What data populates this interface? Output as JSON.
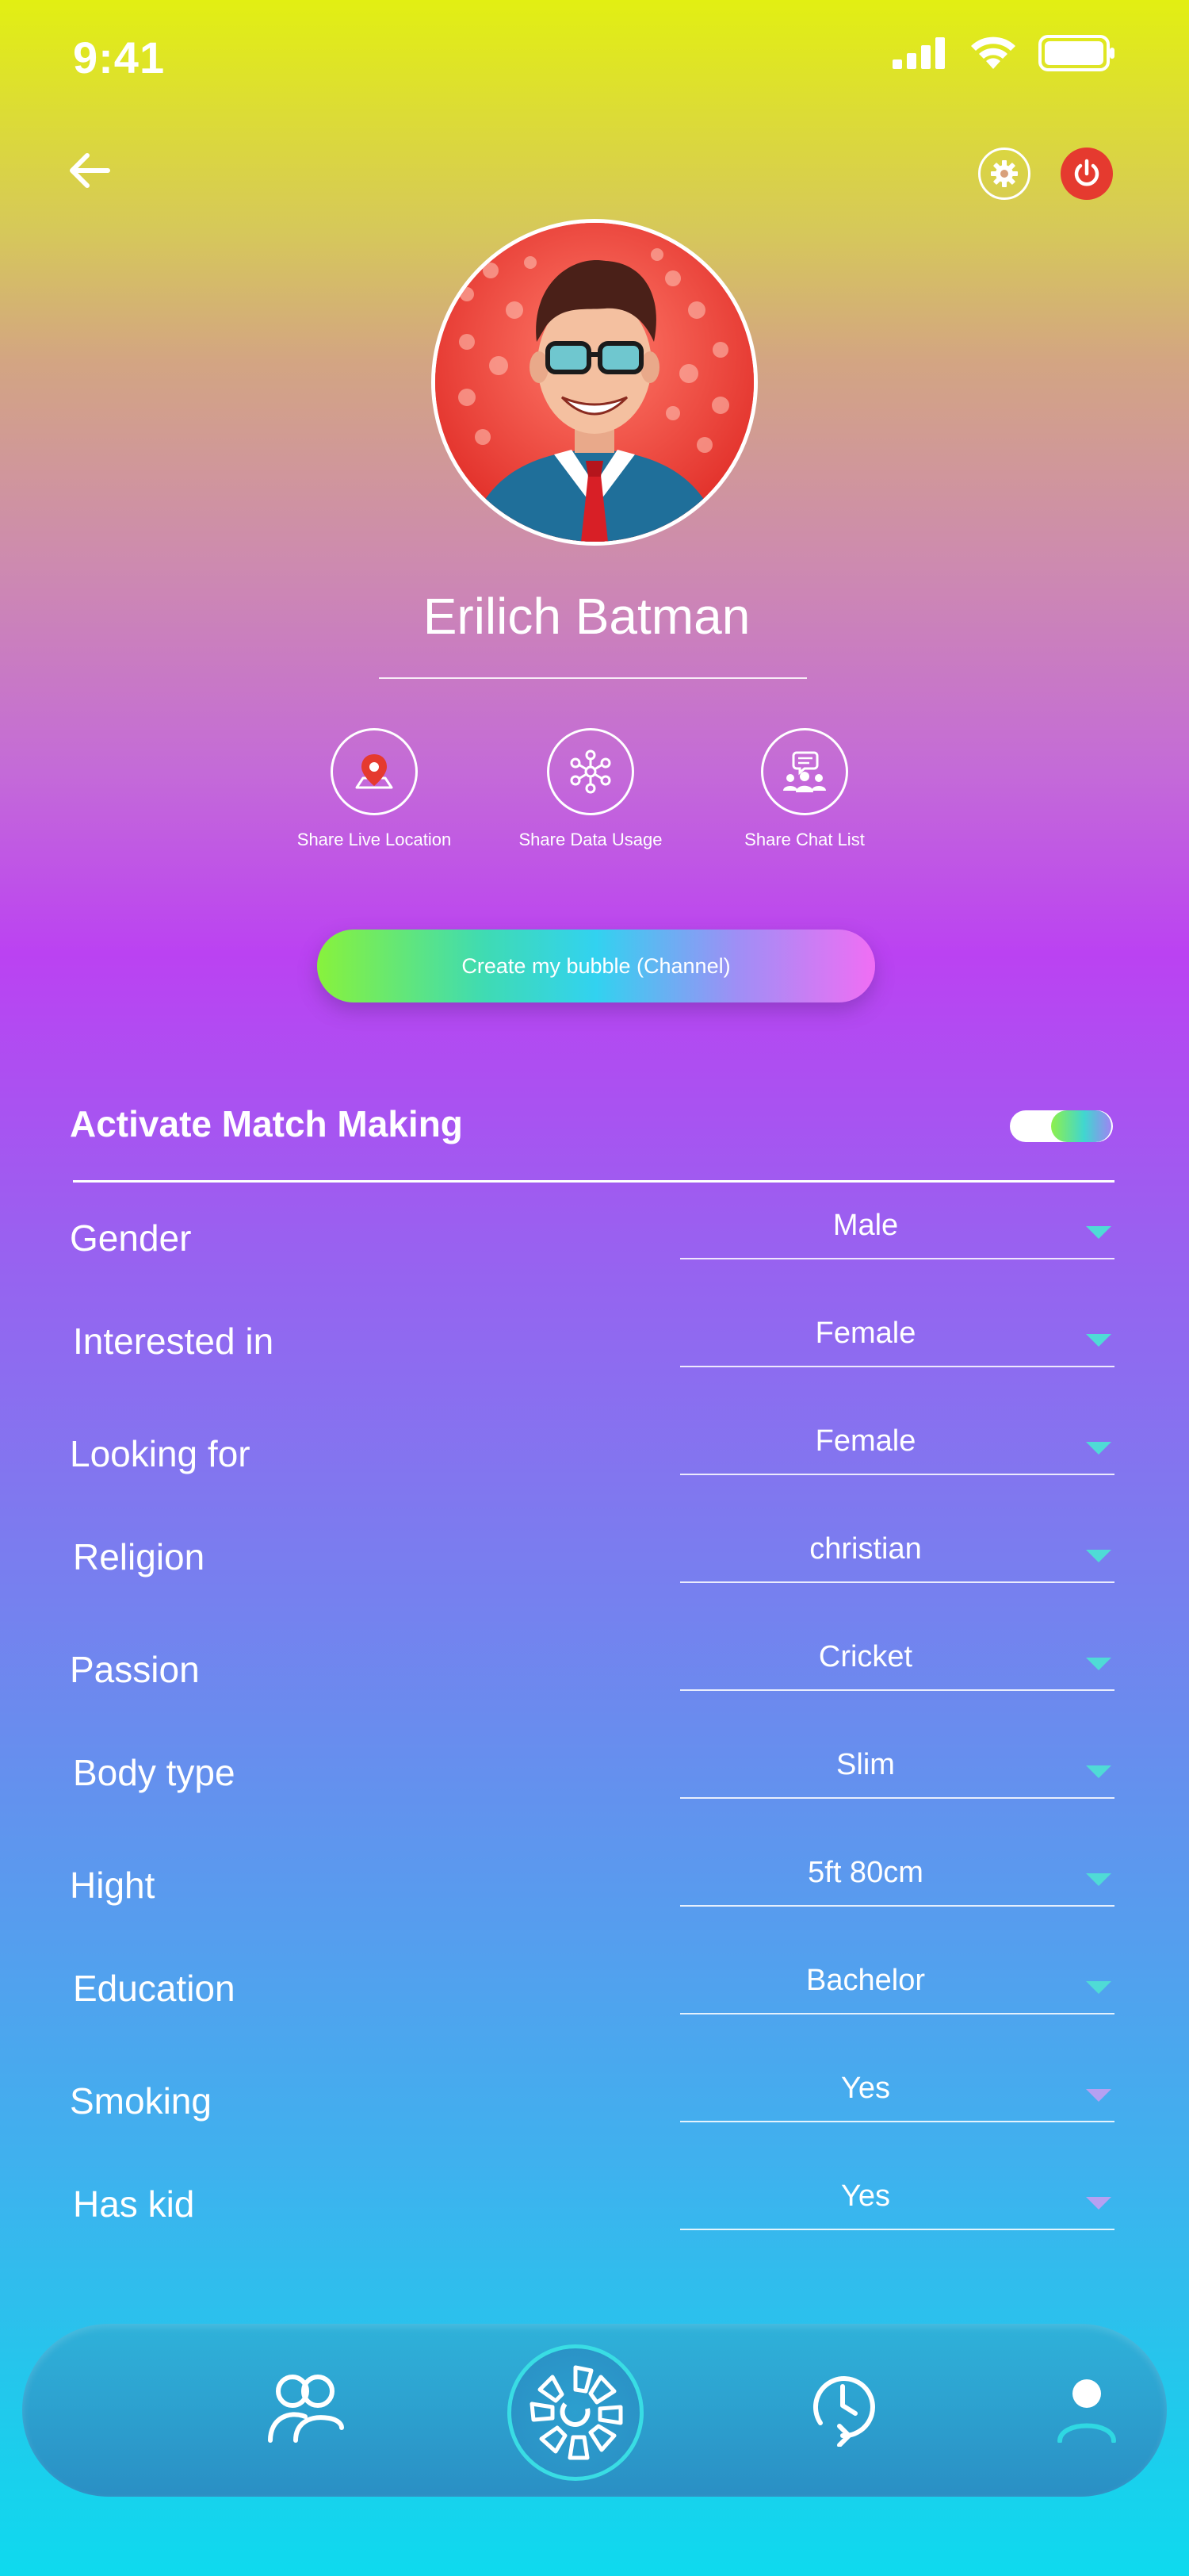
{
  "status_bar": {
    "time": "9:41"
  },
  "profile": {
    "name": "Erilich Batman"
  },
  "share_actions": [
    {
      "label": "Share Live Location",
      "icon": "location-pin-icon"
    },
    {
      "label": "Share Data Usage",
      "icon": "network-icon"
    },
    {
      "label": "Share Chat List",
      "icon": "chat-group-icon"
    }
  ],
  "create_button": {
    "label": "Create my bubble (Channel)"
  },
  "match_making": {
    "title": "Activate Match Making",
    "enabled": true,
    "fields": [
      {
        "label": "Gender",
        "value": "Male"
      },
      {
        "label": "Interested in",
        "value": "Female"
      },
      {
        "label": "Looking for",
        "value": "Female"
      },
      {
        "label": "Religion",
        "value": "christian"
      },
      {
        "label": "Passion",
        "value": "Cricket"
      },
      {
        "label": "Body type",
        "value": "Slim"
      },
      {
        "label": "Hight",
        "value": "5ft 80cm"
      },
      {
        "label": "Education",
        "value": "Bachelor"
      },
      {
        "label": "Smoking",
        "value": "Yes"
      },
      {
        "label": "Has kid",
        "value": "Yes"
      }
    ]
  },
  "bottom_nav": [
    "friends-icon",
    "bubble-wheel-icon",
    "history-icon",
    "profile-icon"
  ],
  "colors": {
    "power": "#e53a2f",
    "dropdown_arrow": "#4fdbd6",
    "nav_ring": "#39dde4"
  }
}
